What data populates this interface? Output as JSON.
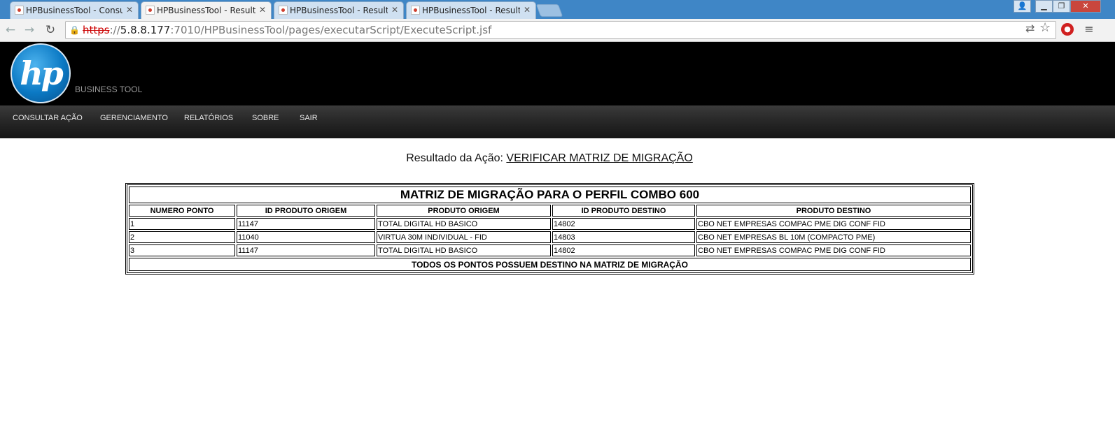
{
  "browser": {
    "tabs": [
      {
        "title": "HPBusinessTool - Consulta",
        "active": false
      },
      {
        "title": "HPBusinessTool - Resultado",
        "active": true
      },
      {
        "title": "HPBusinessTool - Resultado",
        "active": false
      },
      {
        "title": "HPBusinessTool - Resultado",
        "active": false
      }
    ],
    "url": {
      "scheme": "https",
      "sep": "://",
      "host": "5.8.8.177",
      "path": ":7010/HPBusinessTool/pages/executarScript/ExecuteScript.jsf"
    }
  },
  "header": {
    "logo_text": "hp",
    "subtitle": "BUSINESS TOOL"
  },
  "menu": [
    "CONSULTAR AÇÃO",
    "GERENCIAMENTO",
    "RELATÓRIOS",
    "SOBRE",
    "SAIR"
  ],
  "result": {
    "label": "Resultado da Ação: ",
    "action_link": "VERIFICAR MATRIZ DE MIGRAÇÃO"
  },
  "table": {
    "title": "MATRIZ DE MIGRAÇÃO PARA O PERFIL COMBO 600",
    "columns": [
      "NUMERO PONTO",
      "ID PRODUTO ORIGEM",
      "PRODUTO ORIGEM",
      "ID PRODUTO DESTINO",
      "PRODUTO DESTINO"
    ],
    "rows": [
      [
        "1",
        "11147",
        "TOTAL DIGITAL HD BASICO",
        "14802",
        "CBO NET EMPRESAS COMPAC PME DIG CONF FID"
      ],
      [
        "2",
        "11040",
        "VIRTUA 30M INDIVIDUAL - FID",
        "14803",
        "CBO NET EMPRESAS BL 10M (COMPACTO PME)"
      ],
      [
        "3",
        "11147",
        "TOTAL DIGITAL HD BASICO",
        "14802",
        "CBO NET EMPRESAS COMPAC PME DIG CONF FID"
      ]
    ],
    "footer": "TODOS OS PONTOS POSSUEM DESTINO NA MATRIZ DE MIGRAÇÃO"
  }
}
